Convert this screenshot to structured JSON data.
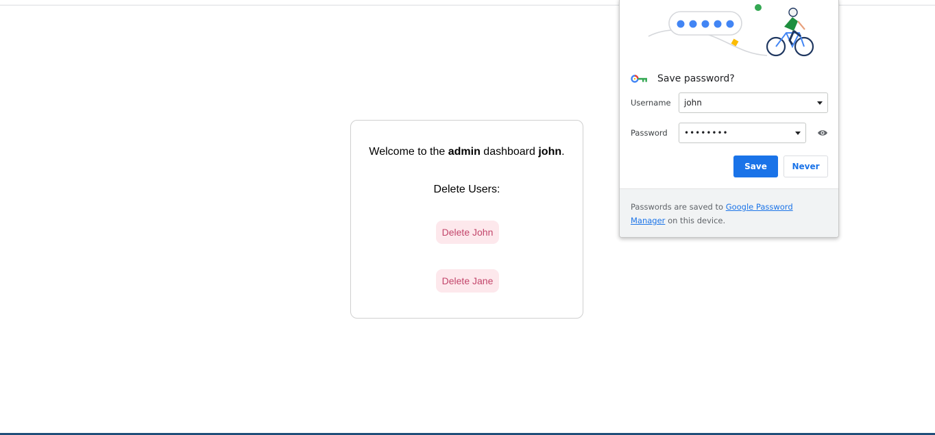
{
  "dashboard": {
    "welcome_prefix": "Welcome to the ",
    "welcome_role": "admin",
    "welcome_middle": " dashboard ",
    "welcome_user": "john",
    "welcome_suffix": ".",
    "delete_heading": "Delete Users:",
    "buttons": [
      {
        "label": "Delete John"
      },
      {
        "label": "Delete Jane"
      }
    ]
  },
  "password_bubble": {
    "title": "Save password?",
    "username_label": "Username",
    "username_value": "john",
    "password_label": "Password",
    "password_value": "••••••••",
    "save_label": "Save",
    "never_label": "Never",
    "footer_prefix": "Passwords are saved to ",
    "footer_link": "Google Password Manager",
    "footer_suffix": " on this device."
  },
  "colors": {
    "accent": "#1a73e8",
    "delete_button_bg": "#fde8ec",
    "delete_button_text": "#c2456a"
  },
  "icons": [
    "key-icon",
    "eye-icon",
    "chevron-down-icon"
  ]
}
